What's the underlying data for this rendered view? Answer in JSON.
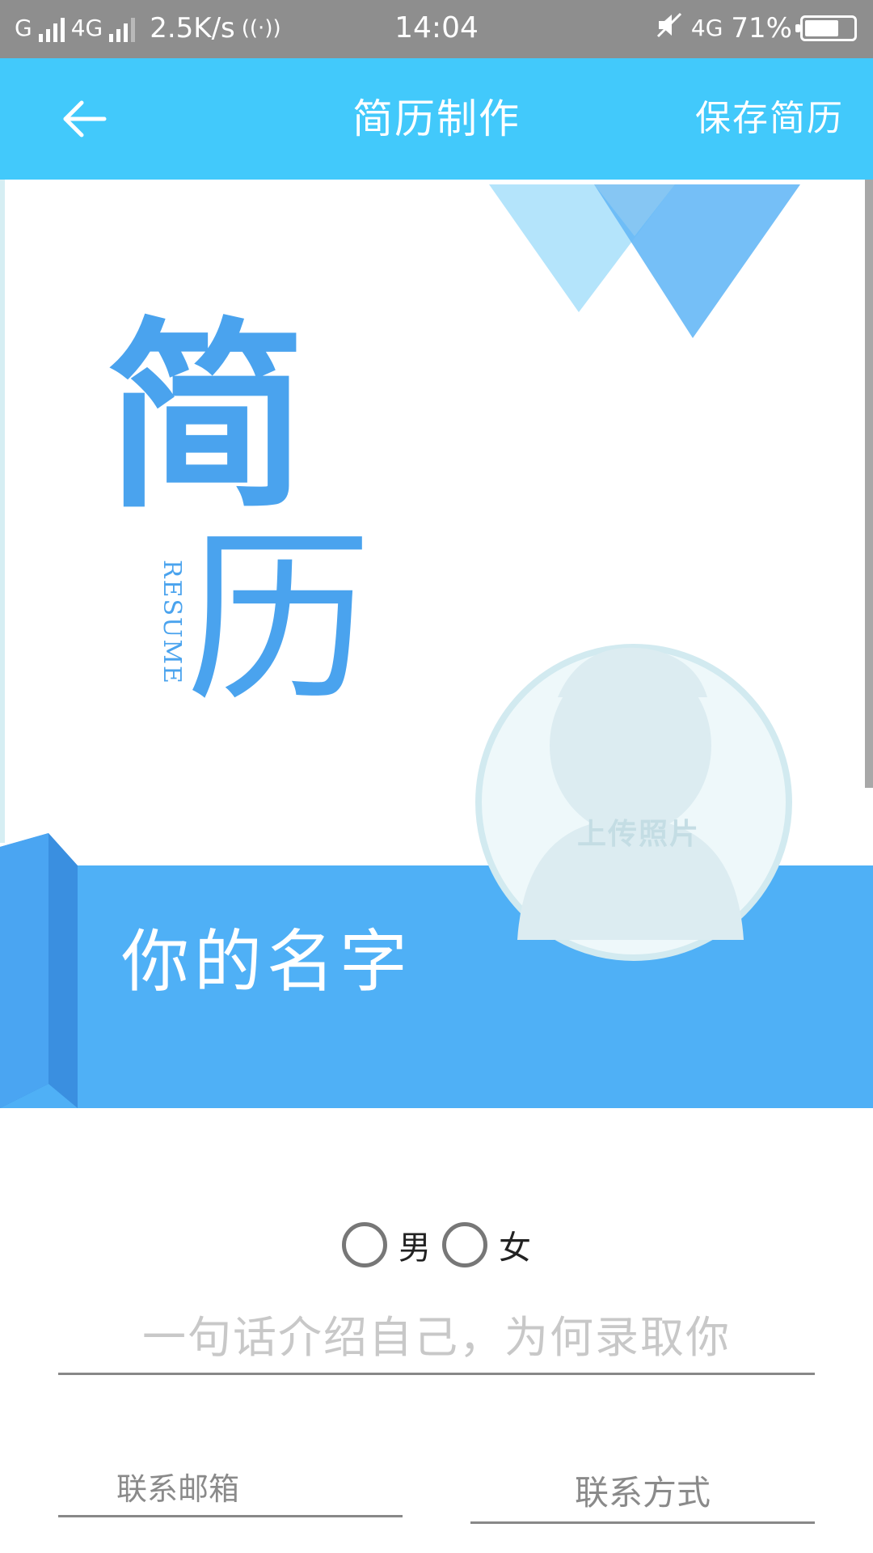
{
  "status_bar": {
    "carrier1": "G",
    "carrier2": "4G",
    "speed": "2.5K/s",
    "time": "14:04",
    "network_right": "4G",
    "battery_percent": "71%",
    "battery_level": 0.71,
    "icons": [
      "signal-icon",
      "hotspot-icon",
      "mute-icon",
      "battery-icon"
    ]
  },
  "app_bar": {
    "back_icon": "arrow-left-icon",
    "title": "简历制作",
    "save_label": "保存简历",
    "color": "#42c9fb"
  },
  "cover": {
    "char1": "简",
    "char2": "历",
    "resume_word": "RESUME",
    "name_placeholder": "你的名字",
    "photo_label": "上传照片",
    "accent": "#4fb0f6"
  },
  "form": {
    "gender_options": [
      "男",
      "女"
    ],
    "intro_placeholder": "一句话介绍自己，为何录取你",
    "email_placeholder": "联系邮箱",
    "phone_placeholder": "联系方式"
  }
}
